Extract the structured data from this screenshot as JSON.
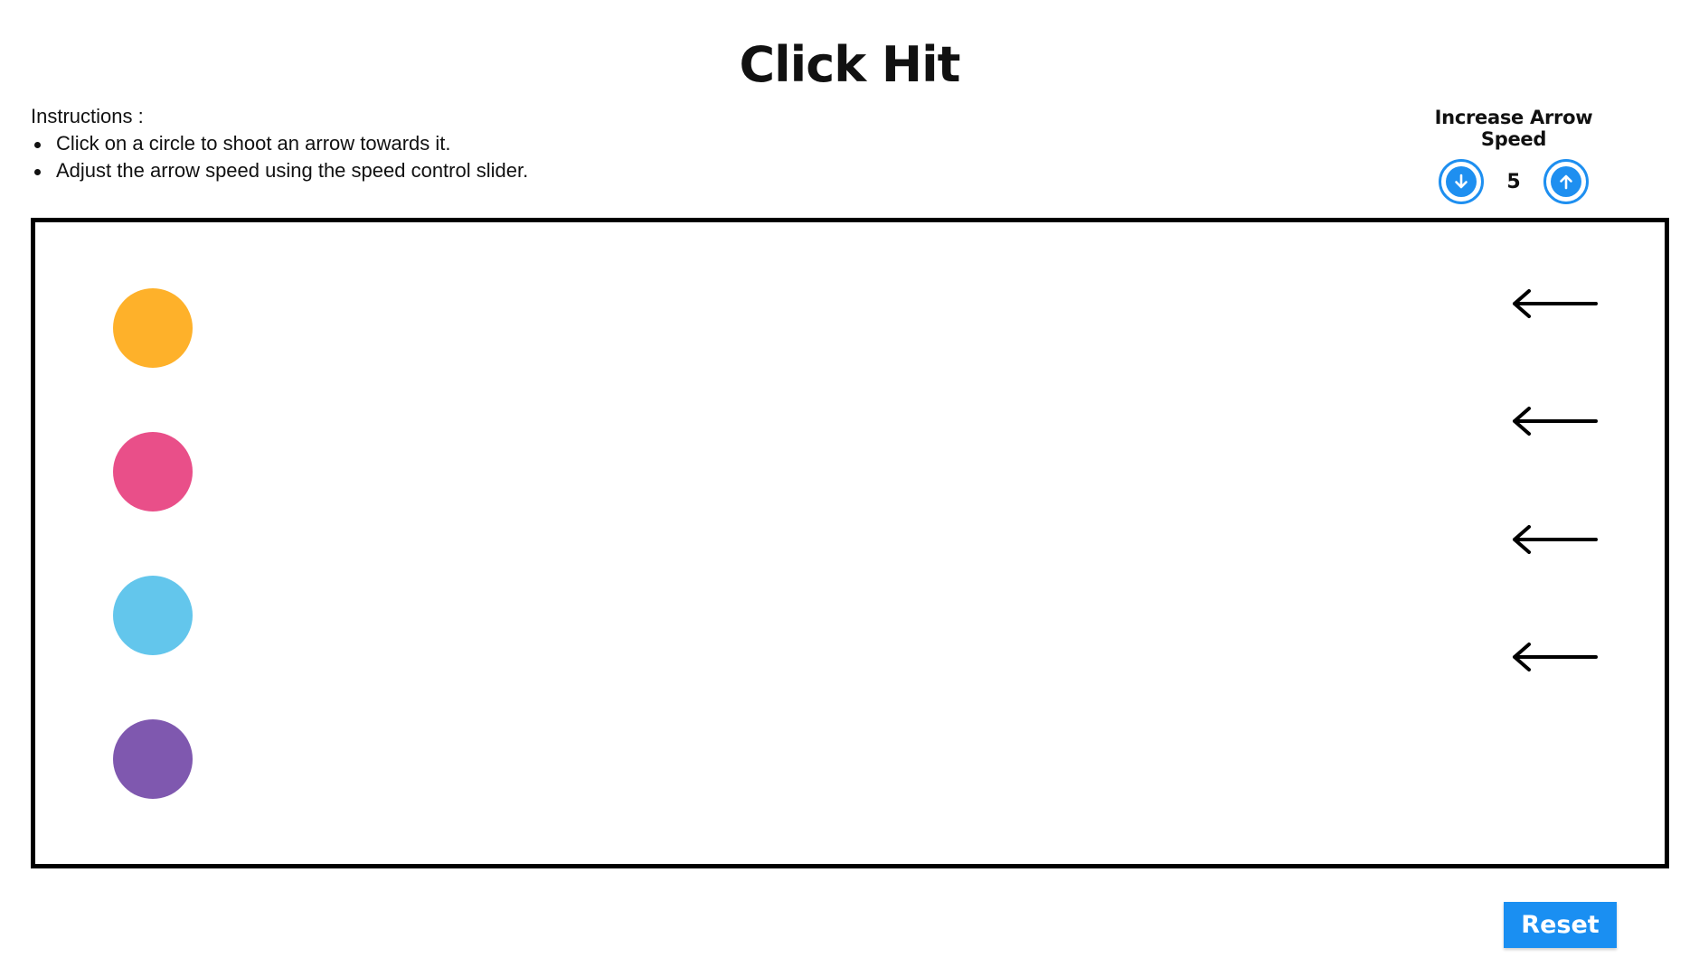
{
  "title": "Click Hit",
  "instructions": {
    "heading": "Instructions :",
    "items": [
      "Click on a circle to shoot an arrow towards it.",
      "Adjust the arrow speed using the speed control slider."
    ]
  },
  "speed_control": {
    "label": "Increase Arrow Speed",
    "value": "5",
    "decrease_icon": "arrow-down-circle-icon",
    "increase_icon": "arrow-up-circle-icon",
    "accent_color": "#1e8ff0"
  },
  "targets": [
    {
      "name": "orange",
      "color": "#FEB12A"
    },
    {
      "name": "pink",
      "color": "#E94F89"
    },
    {
      "name": "blue",
      "color": "#63C6EC"
    },
    {
      "name": "purple",
      "color": "#7F58AF"
    }
  ],
  "arrows": {
    "count": 4,
    "icon": "left-arrow-icon",
    "color": "#000000"
  },
  "reset_button": {
    "label": "Reset",
    "color": "#1a8ff2"
  }
}
